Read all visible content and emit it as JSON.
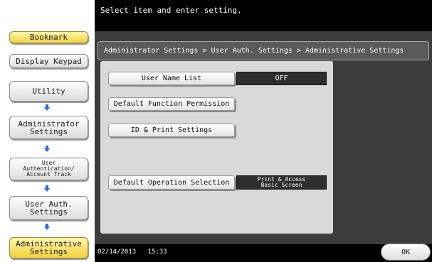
{
  "sidebar": {
    "bookmark": "Bookmark",
    "display_keypad": "Display Keypad",
    "utility": "Utility",
    "admin_settings": "Administrator\nSettings",
    "user_auth_account": "User\nAuthentication/\nAccount Track",
    "user_auth_settings": "User Auth.\nSettings",
    "administrative_settings": "Administrative\nSettings"
  },
  "header": {
    "message": "Select item and enter setting."
  },
  "breadcrumb": "Administrator Settings > User Auth. Settings > Administrative Settings",
  "settings": {
    "user_name_list": {
      "label": "User Name List",
      "value": "OFF"
    },
    "default_function_permission": {
      "label": "Default Function Permission"
    },
    "id_print_settings": {
      "label": "ID & Print Settings"
    },
    "default_operation_selection": {
      "label": "Default Operation Selection",
      "value": "Print & Access\nBasic Screen"
    }
  },
  "footer": {
    "date": "02/14/2013",
    "time": "15:33",
    "ok_label": "OK"
  },
  "colors": {
    "highlight": "#f4d23a",
    "arrow": "#2d6fd6",
    "background": "#3c3c3c"
  }
}
